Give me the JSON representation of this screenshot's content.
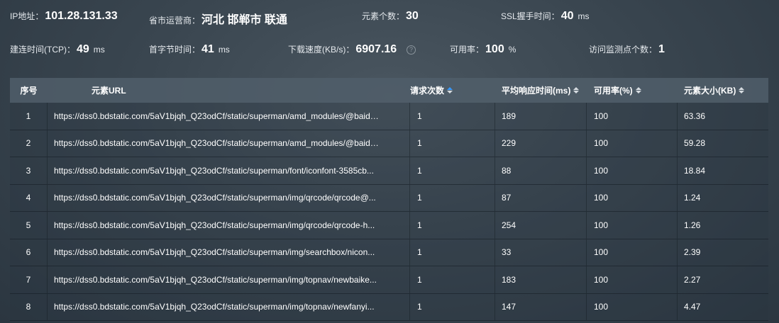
{
  "stats": {
    "ip": {
      "label": "IP地址：",
      "value": "101.28.131.33"
    },
    "isp": {
      "label": "省市运营商：",
      "value": "河北 邯郸市 联通"
    },
    "elements": {
      "label": "元素个数：",
      "value": "30"
    },
    "ssl": {
      "label": "SSL握手时间：",
      "value": "40",
      "unit": "ms"
    },
    "tcp": {
      "label": "建连时间(TCP)：",
      "value": "49",
      "unit": "ms"
    },
    "ttfb": {
      "label": "首字节时间：",
      "value": "41",
      "unit": "ms"
    },
    "speed": {
      "label": "下载速度(KB/s)：",
      "value": "6907.16"
    },
    "availability": {
      "label": "可用率：",
      "value": "100",
      "unit": "%"
    },
    "monitors": {
      "label": "访问监测点个数：",
      "value": "1"
    }
  },
  "table": {
    "headers": [
      "序号",
      "元素URL",
      "请求次数",
      "平均响应时间(ms)",
      "可用率(%)",
      "元素大小(KB)"
    ],
    "rows": [
      {
        "idx": "1",
        "url": "https://dss0.bdstatic.com/5aV1bjqh_Q23odCf/static/superman/amd_modules/@baidu...",
        "count": "1",
        "avg": "189",
        "avail": "100",
        "size": "63.36"
      },
      {
        "idx": "2",
        "url": "https://dss0.bdstatic.com/5aV1bjqh_Q23odCf/static/superman/amd_modules/@baidu...",
        "count": "1",
        "avg": "229",
        "avail": "100",
        "size": "59.28"
      },
      {
        "idx": "3",
        "url": "https://dss0.bdstatic.com/5aV1bjqh_Q23odCf/static/superman/font/iconfont-3585cb...",
        "count": "1",
        "avg": "88",
        "avail": "100",
        "size": "18.84"
      },
      {
        "idx": "4",
        "url": "https://dss0.bdstatic.com/5aV1bjqh_Q23odCf/static/superman/img/qrcode/qrcode@...",
        "count": "1",
        "avg": "87",
        "avail": "100",
        "size": "1.24"
      },
      {
        "idx": "5",
        "url": "https://dss0.bdstatic.com/5aV1bjqh_Q23odCf/static/superman/img/qrcode/qrcode-h...",
        "count": "1",
        "avg": "254",
        "avail": "100",
        "size": "1.26"
      },
      {
        "idx": "6",
        "url": "https://dss0.bdstatic.com/5aV1bjqh_Q23odCf/static/superman/img/searchbox/nicon...",
        "count": "1",
        "avg": "33",
        "avail": "100",
        "size": "2.39"
      },
      {
        "idx": "7",
        "url": "https://dss0.bdstatic.com/5aV1bjqh_Q23odCf/static/superman/img/topnav/newbaike...",
        "count": "1",
        "avg": "183",
        "avail": "100",
        "size": "2.27"
      },
      {
        "idx": "8",
        "url": "https://dss0.bdstatic.com/5aV1bjqh_Q23odCf/static/superman/img/topnav/newfanyi...",
        "count": "1",
        "avg": "147",
        "avail": "100",
        "size": "4.47"
      }
    ]
  },
  "colors": {
    "sort_active": "#3b9cff"
  },
  "icons": {
    "help": "question-circle-icon"
  }
}
